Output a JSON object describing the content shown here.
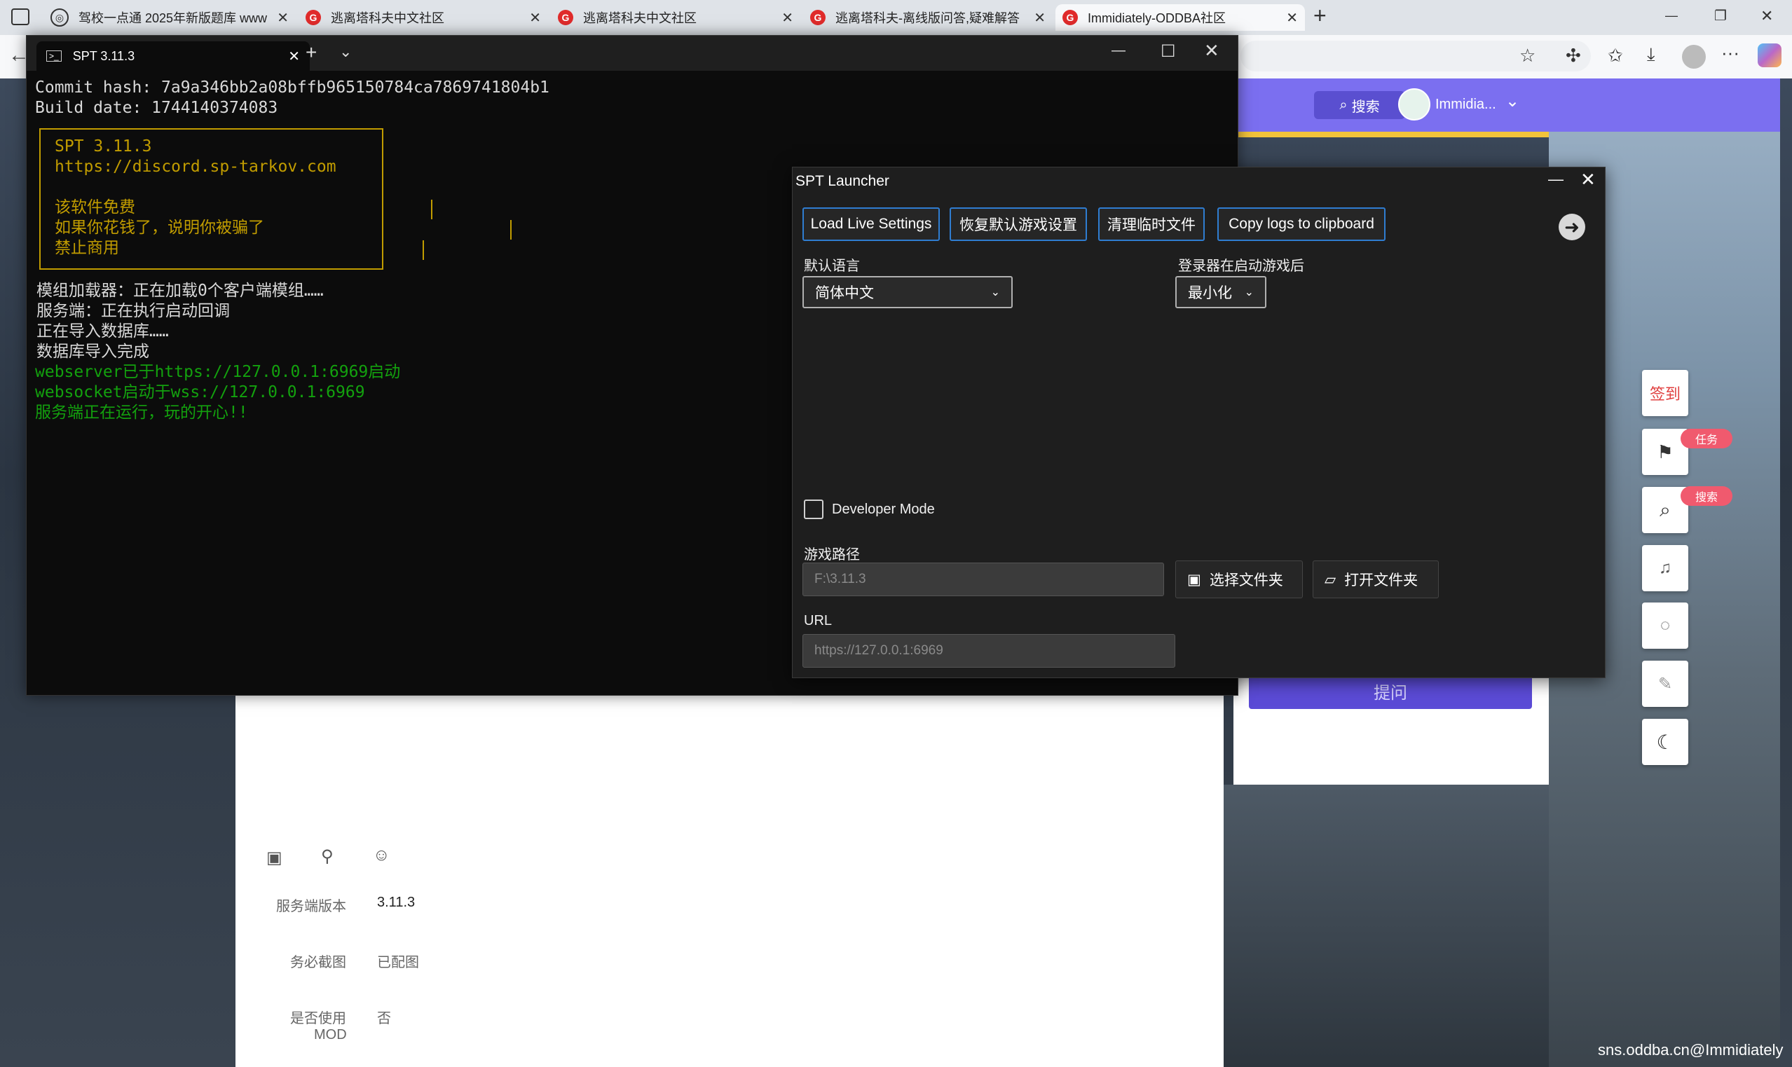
{
  "browser": {
    "tabs": [
      {
        "label": "驾校一点通 2025年新版题库 www",
        "icon": "globe-icon"
      },
      {
        "label": "逃离塔科夫中文社区",
        "icon": "site-logo-icon"
      },
      {
        "label": "逃离塔科夫中文社区",
        "icon": "site-logo-icon"
      },
      {
        "label": "逃离塔科夫-离线版问答,疑难解答",
        "icon": "site-logo-icon"
      },
      {
        "label": "Immidiately-ODDBA社区",
        "icon": "site-logo-icon"
      }
    ],
    "new_tab": "+",
    "window_controls": {
      "minimize": "—",
      "maximize": "❐",
      "close": "✕"
    }
  },
  "site": {
    "search_label": "搜索",
    "username": "Immidia...",
    "ask_button": "提问",
    "watermark": "sns.oddba.cn@Immidiately",
    "form": {
      "server_version_label": "服务端版本",
      "server_version_value": "3.11.3",
      "screenshot_label": "务必截图",
      "screenshot_value": "已配图",
      "mod_label_line1": "是否使用",
      "mod_label_line2": "MOD",
      "mod_value": "否"
    },
    "floating": {
      "checkin": "签到",
      "task_tag": "任务",
      "search_tag": "搜索"
    }
  },
  "terminal": {
    "tab_title": "SPT 3.11.3",
    "lines": [
      "Commit hash: 7a9a346bb2a08bffb965150784ca7869741804b1",
      "Build date: 1744140374083"
    ],
    "banner": [
      "SPT 3.11.3",
      "https://discord.sp-tarkov.com",
      "",
      "该软件免费",
      "如果你花钱了，说明你被骗了",
      "禁止商用"
    ],
    "log_lines": [
      "模组加载器：正在加载0个客户端模组……",
      "服务端：正在执行启动回调",
      "正在导入数据库……",
      "数据库导入完成"
    ],
    "green_lines": [
      "webserver已于https://127.0.0.1:6969启动",
      "websocket启动于wss://127.0.0.1:6969",
      "服务端正在运行，玩的开心!!"
    ]
  },
  "launcher": {
    "title": "SPT Launcher",
    "buttons": {
      "load_live": "Load Live Settings",
      "restore_defaults": "恢复默认游戏设置",
      "clear_temp": "清理临时文件",
      "copy_logs": "Copy logs to clipboard"
    },
    "language_label": "默认语言",
    "language_value": "简体中文",
    "after_launch_label": "登录器在启动游戏后",
    "after_launch_value": "最小化",
    "developer_mode_label": "Developer Mode",
    "developer_mode_checked": false,
    "game_path_label": "游戏路径",
    "game_path_value": "F:\\3.11.3",
    "select_folder": "选择文件夹",
    "open_folder": "打开文件夹",
    "url_label": "URL",
    "url_value": "https://127.0.0.1:6969"
  },
  "colors": {
    "accent_purple": "#7b6ff0",
    "terminal_green": "#13a10e",
    "terminal_yellow": "#c19c00",
    "launcher_button_border": "#2f7dd1"
  }
}
